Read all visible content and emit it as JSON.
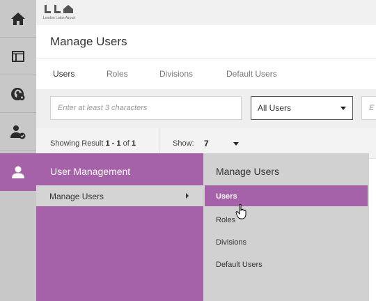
{
  "brand": {
    "logo_text": "London Luton Airport",
    "logo_icon": "luton-airport-logo"
  },
  "rail": {
    "items": [
      {
        "icon": "home-icon"
      },
      {
        "icon": "layout-icon"
      },
      {
        "icon": "globe-settings-icon"
      },
      {
        "icon": "user-check-icon"
      },
      {
        "icon": "user-icon"
      }
    ]
  },
  "page": {
    "title": "Manage Users"
  },
  "tabs": [
    {
      "label": "Users"
    },
    {
      "label": "Roles"
    },
    {
      "label": "Divisions"
    },
    {
      "label": "Default Users"
    }
  ],
  "filters": {
    "search_placeholder": "Enter at least 3 characters",
    "select_value": "All Users",
    "extra_placeholder": "E"
  },
  "results": {
    "showing_prefix": "Showing Result",
    "showing_range": "1 - 1",
    "showing_of": "of",
    "showing_total": "1",
    "show_label": "Show:",
    "show_value": "7"
  },
  "menu": {
    "header": "User Management",
    "item_label": "Manage Users",
    "submenu_header": "Manage Users",
    "submenu_items": [
      {
        "label": "Users"
      },
      {
        "label": "Roles"
      },
      {
        "label": "Divisions"
      },
      {
        "label": "Default Users"
      }
    ]
  },
  "colors": {
    "accent": "#a562a8",
    "rail_bg": "#c8c8c8",
    "submenu_bg": "#d1d1d1"
  }
}
